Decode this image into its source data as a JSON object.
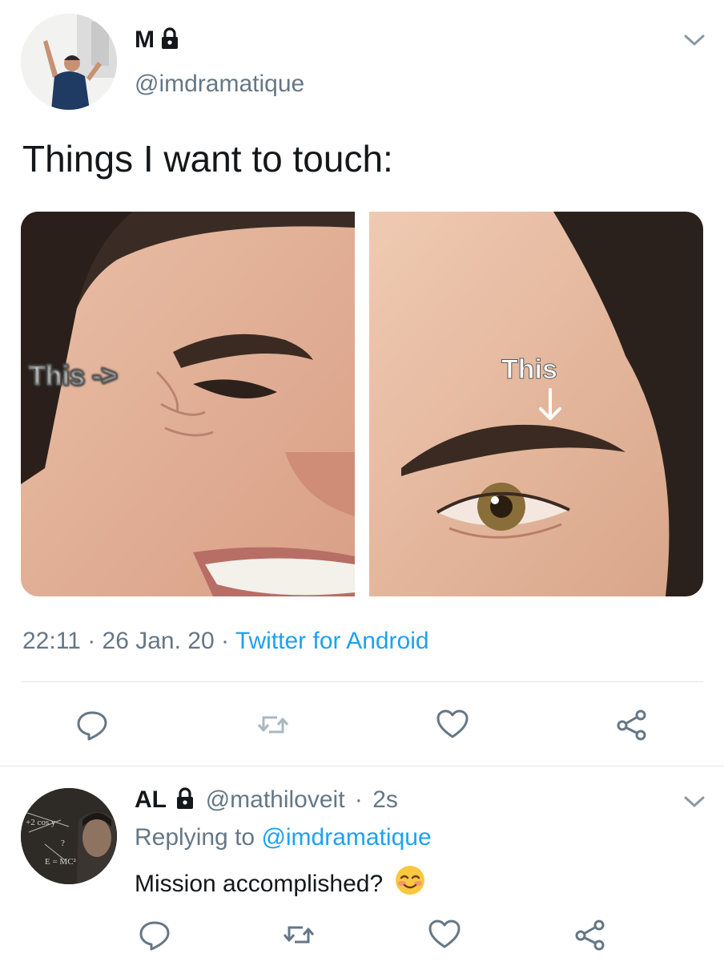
{
  "tweet": {
    "display_name": "M",
    "handle": "@imdramatique",
    "text": "Things I want to touch:",
    "media": {
      "left_caption": "This ->",
      "right_caption": "This"
    },
    "time": "22:11",
    "separator": "·",
    "date": "26 Jan. 20",
    "source": "Twitter for Android",
    "actions": {
      "reply_icon": "reply-icon",
      "retweet_icon": "retweet-icon",
      "like_icon": "heart-icon",
      "share_icon": "share-icon"
    }
  },
  "reply": {
    "display_name": "AL",
    "handle": "@mathiloveit",
    "separator": "·",
    "age": "2s",
    "replying_prefix": "Replying to",
    "replying_to": "@imdramatique",
    "text": "Mission accomplished?",
    "emoji": "smiling-face-with-blush-emoji"
  },
  "colors": {
    "text": "#14171a",
    "secondary": "#657786",
    "accent": "#1da1f2",
    "divider": "#e1e8ed"
  }
}
